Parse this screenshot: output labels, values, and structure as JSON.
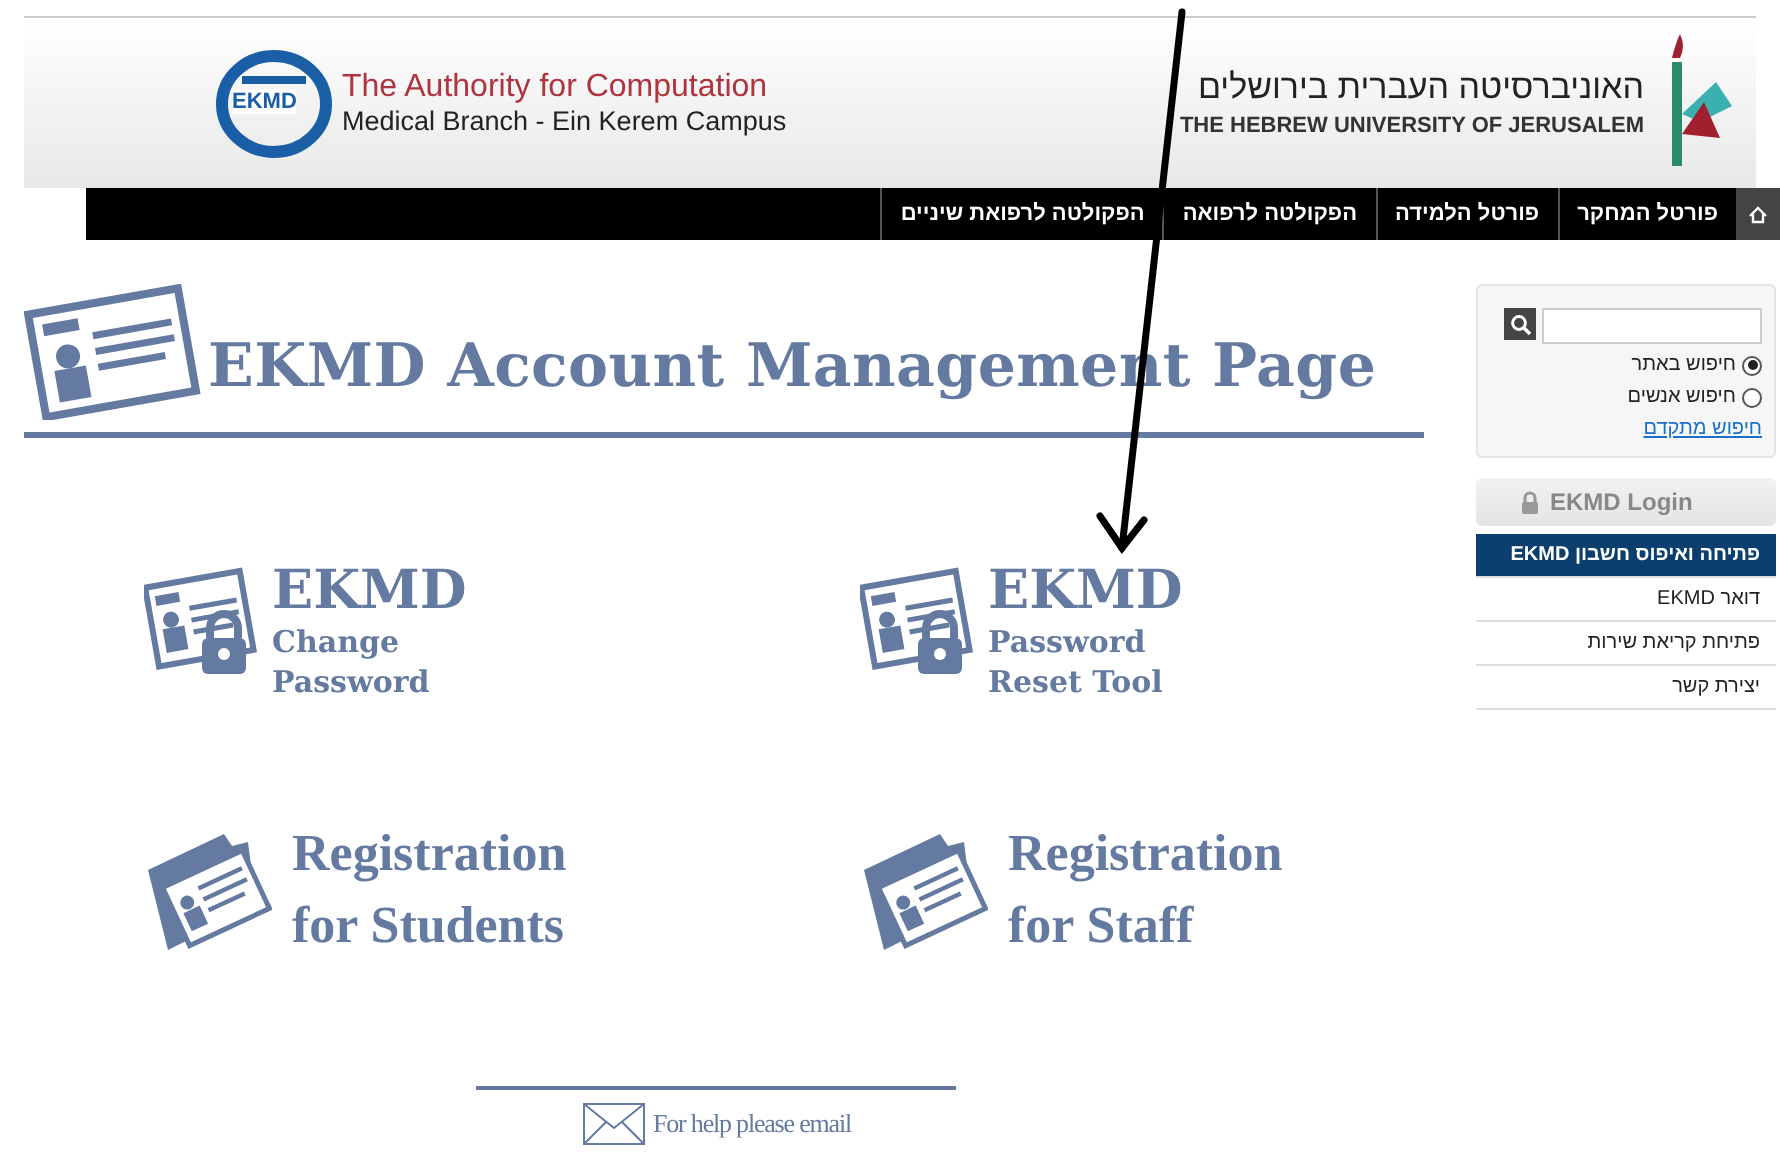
{
  "header": {
    "ekmd_logo": {
      "badge": "EKMD",
      "title": "The Authority for Computation",
      "subtitle": "Medical Branch - Ein Kerem Campus"
    },
    "university": {
      "name_hebrew": "האוניברסיטה העברית בירושלים",
      "name_english": "THE HEBREW UNIVERSITY OF JERUSALEM"
    }
  },
  "nav": [
    {
      "label": "פורטל המחקר"
    },
    {
      "label": "פורטל הלמידה"
    },
    {
      "label": "הפקולטה לרפואה"
    },
    {
      "label": "הפקולטה לרפואת שיניים"
    }
  ],
  "page_title": "EKMD Account Management Page",
  "tile_rows": [
    {
      "left": {
        "kind": "lock",
        "lines": [
          "EKMD",
          "Change",
          "Password"
        ]
      },
      "right": {
        "kind": "lock",
        "lines": [
          "EKMD",
          "Password",
          "Reset Tool"
        ]
      }
    },
    {
      "left": {
        "kind": "folder",
        "lines": [
          "Registration",
          "for Students"
        ]
      },
      "right": {
        "kind": "folder",
        "lines": [
          "Registration",
          "for Staff"
        ]
      }
    }
  ],
  "help": "For help please email",
  "sidebar": {
    "search": {
      "options": [
        {
          "label": "חיפוש באתר",
          "selected": true
        },
        {
          "label": "חיפוש אנשים",
          "selected": false
        }
      ],
      "advanced_link": "חיפוש מתקדם"
    },
    "login_header": "EKMD Login",
    "menu": [
      {
        "label": "פתיחה ואיפוס חשבון EKMD",
        "selected": true
      },
      {
        "label": "דואר EKMD",
        "selected": false
      },
      {
        "label": "פתיחת קריאת שירות",
        "selected": false
      },
      {
        "label": "יצירת קשר",
        "selected": false
      }
    ]
  }
}
